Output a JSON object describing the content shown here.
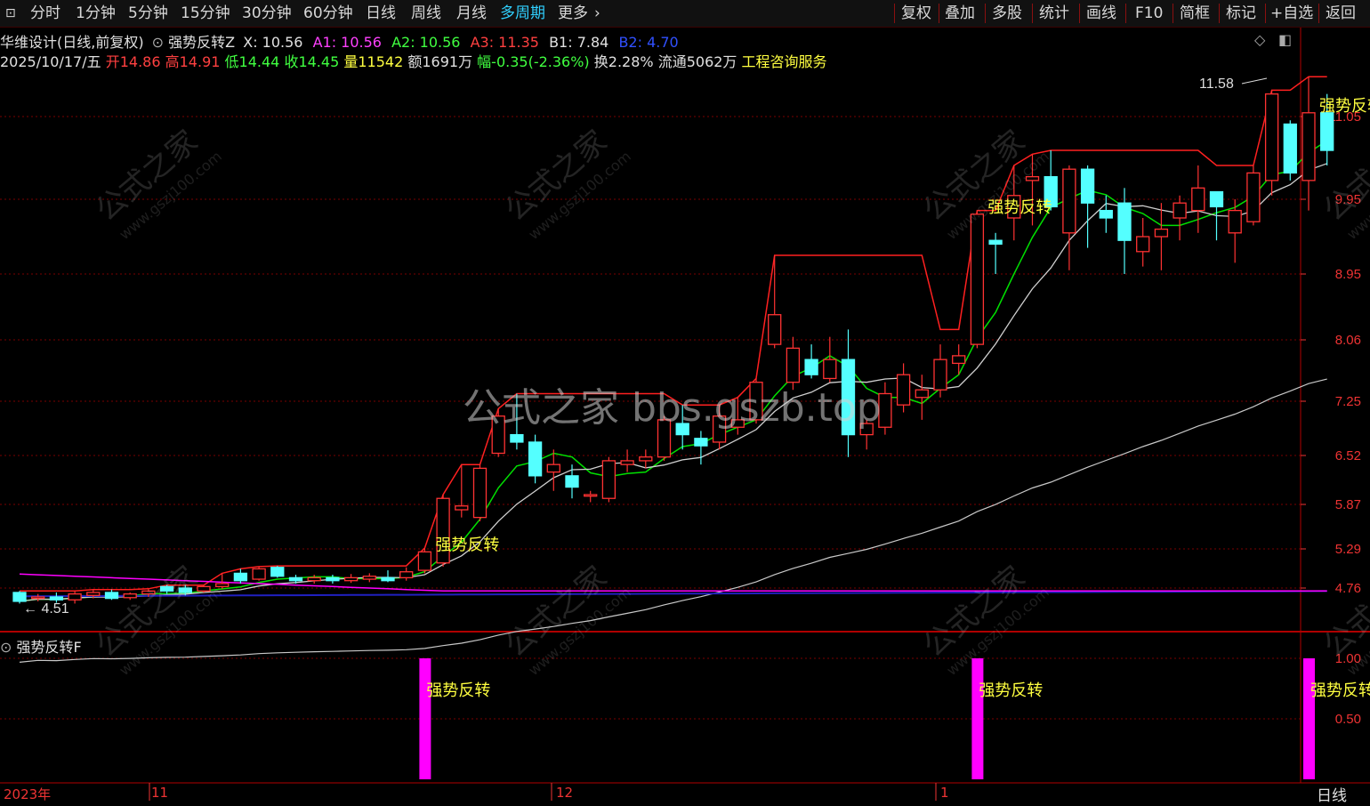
{
  "toolbar": {
    "left": [
      "分时",
      "1分钟",
      "5分钟",
      "15分钟",
      "30分钟",
      "60分钟",
      "日线",
      "周线",
      "月线",
      "多周期",
      "更多"
    ],
    "right": [
      "复权",
      "叠加",
      "多股",
      "统计",
      "画线",
      "F10",
      "简框",
      "标记",
      "+自选",
      "返回"
    ]
  },
  "header": {
    "line1": {
      "title": "华维设计(日线,前复权)",
      "indicator": "强势反转Z",
      "x": "X: 10.56",
      "a1": "A1: 10.56",
      "a2": "A2: 10.56",
      "a3": "A3: 11.35",
      "b1": "B1: 7.84",
      "b2": "B2: 4.70"
    },
    "line2": {
      "date": "2025/10/17/五",
      "open": "开14.86",
      "high": "高14.91",
      "low": "低14.44",
      "close": "收14.45",
      "volume": "量11542",
      "amount": "额1691万",
      "change": "幅-0.35(-2.36%)",
      "turnover": "换2.28%",
      "float": "流通5062万",
      "industry": "工程咨询服务"
    }
  },
  "sub_panel": {
    "title": "强势反转F"
  },
  "bottom": {
    "period_label": "日线",
    "year": "2023年",
    "month_11": "11",
    "month_12": "12",
    "month_1": "1"
  },
  "watermark": "公式之家 bbs.gszb.top",
  "watermark_small": "公式之家",
  "watermark_url": "www.gszj100.com",
  "colors": {
    "up": "#ff3232",
    "down": "#54ffff",
    "ma": "#00e000",
    "white": "#d0d0d0",
    "magenta": "#ff00ff",
    "blue": "#2020c0",
    "grid": "#7a0000",
    "yellow": "#ffff40"
  },
  "chart_data": {
    "type": "candlestick",
    "y_ticks": [
      "11.05",
      "9.95",
      "8.95",
      "8.06",
      "7.25",
      "6.52",
      "5.87",
      "5.29",
      "4.76"
    ],
    "sub_y_ticks": [
      "1.00",
      "0.50"
    ],
    "low_label": "4.51",
    "high_label": "11.58",
    "signal_label": "强势反转",
    "candles": [
      {
        "o": 4.7,
        "c": 4.58,
        "h": 4.72,
        "l": 4.55
      },
      {
        "o": 4.62,
        "c": 4.64,
        "h": 4.68,
        "l": 4.58
      },
      {
        "o": 4.64,
        "c": 4.6,
        "h": 4.7,
        "l": 4.56
      },
      {
        "o": 4.6,
        "c": 4.68,
        "h": 4.72,
        "l": 4.55
      },
      {
        "o": 4.66,
        "c": 4.7,
        "h": 4.74,
        "l": 4.62
      },
      {
        "o": 4.7,
        "c": 4.62,
        "h": 4.74,
        "l": 4.6
      },
      {
        "o": 4.63,
        "c": 4.68,
        "h": 4.7,
        "l": 4.6
      },
      {
        "o": 4.68,
        "c": 4.72,
        "h": 4.75,
        "l": 4.64
      },
      {
        "o": 4.78,
        "c": 4.72,
        "h": 4.8,
        "l": 4.68
      },
      {
        "o": 4.76,
        "c": 4.7,
        "h": 4.8,
        "l": 4.66
      },
      {
        "o": 4.72,
        "c": 4.78,
        "h": 4.8,
        "l": 4.7
      },
      {
        "o": 4.78,
        "c": 4.82,
        "h": 4.96,
        "l": 4.75
      },
      {
        "o": 4.96,
        "c": 4.86,
        "h": 5.02,
        "l": 4.82
      },
      {
        "o": 4.88,
        "c": 5.02,
        "h": 5.05,
        "l": 4.86
      },
      {
        "o": 5.04,
        "c": 4.92,
        "h": 5.06,
        "l": 4.9
      },
      {
        "o": 4.9,
        "c": 4.86,
        "h": 4.94,
        "l": 4.82
      },
      {
        "o": 4.86,
        "c": 4.9,
        "h": 4.94,
        "l": 4.82
      },
      {
        "o": 4.9,
        "c": 4.86,
        "h": 4.94,
        "l": 4.82
      },
      {
        "o": 4.86,
        "c": 4.9,
        "h": 4.95,
        "l": 4.83
      },
      {
        "o": 4.88,
        "c": 4.92,
        "h": 4.96,
        "l": 4.84
      },
      {
        "o": 4.9,
        "c": 4.86,
        "h": 5.0,
        "l": 4.84
      },
      {
        "o": 4.9,
        "c": 4.98,
        "h": 5.04,
        "l": 4.86
      },
      {
        "o": 5.0,
        "c": 5.25,
        "h": 5.3,
        "l": 4.96
      },
      {
        "o": 5.1,
        "c": 5.95,
        "h": 6.0,
        "l": 5.05
      },
      {
        "o": 5.8,
        "c": 5.85,
        "h": 6.4,
        "l": 5.7
      },
      {
        "o": 5.7,
        "c": 6.35,
        "h": 6.4,
        "l": 5.65
      },
      {
        "o": 6.55,
        "c": 7.05,
        "h": 7.15,
        "l": 6.5
      },
      {
        "o": 6.8,
        "c": 6.7,
        "h": 7.35,
        "l": 6.6
      },
      {
        "o": 6.7,
        "c": 6.25,
        "h": 6.8,
        "l": 6.15
      },
      {
        "o": 6.3,
        "c": 6.4,
        "h": 6.6,
        "l": 6.05
      },
      {
        "o": 6.25,
        "c": 6.1,
        "h": 6.4,
        "l": 5.95
      },
      {
        "o": 5.98,
        "c": 6.0,
        "h": 6.05,
        "l": 5.9
      },
      {
        "o": 5.95,
        "c": 6.45,
        "h": 6.5,
        "l": 5.9
      },
      {
        "o": 6.4,
        "c": 6.45,
        "h": 6.6,
        "l": 6.3
      },
      {
        "o": 6.45,
        "c": 6.5,
        "h": 6.6,
        "l": 6.35
      },
      {
        "o": 6.5,
        "c": 7.0,
        "h": 7.05,
        "l": 6.45
      },
      {
        "o": 6.95,
        "c": 6.8,
        "h": 7.2,
        "l": 6.6
      },
      {
        "o": 6.75,
        "c": 6.65,
        "h": 6.85,
        "l": 6.4
      },
      {
        "o": 6.7,
        "c": 7.05,
        "h": 7.2,
        "l": 6.6
      },
      {
        "o": 6.9,
        "c": 7.0,
        "h": 7.3,
        "l": 6.8
      },
      {
        "o": 7.0,
        "c": 7.5,
        "h": 7.55,
        "l": 6.95
      },
      {
        "o": 8.0,
        "c": 8.4,
        "h": 9.2,
        "l": 7.95
      },
      {
        "o": 7.5,
        "c": 7.95,
        "h": 8.1,
        "l": 7.4
      },
      {
        "o": 7.8,
        "c": 7.6,
        "h": 8.0,
        "l": 7.55
      },
      {
        "o": 7.55,
        "c": 7.8,
        "h": 8.1,
        "l": 7.5
      },
      {
        "o": 7.8,
        "c": 6.8,
        "h": 8.2,
        "l": 6.5
      },
      {
        "o": 6.8,
        "c": 6.95,
        "h": 7.0,
        "l": 6.6
      },
      {
        "o": 6.9,
        "c": 7.35,
        "h": 7.5,
        "l": 6.8
      },
      {
        "o": 7.2,
        "c": 7.6,
        "h": 7.75,
        "l": 7.1
      },
      {
        "o": 7.3,
        "c": 7.4,
        "h": 7.6,
        "l": 7.0
      },
      {
        "o": 7.4,
        "c": 7.8,
        "h": 8.0,
        "l": 7.3
      },
      {
        "o": 7.75,
        "c": 7.85,
        "h": 8.0,
        "l": 7.6
      },
      {
        "o": 8.0,
        "c": 9.75,
        "h": 9.8,
        "l": 7.95
      },
      {
        "o": 9.4,
        "c": 9.35,
        "h": 9.5,
        "l": 8.95
      },
      {
        "o": 9.7,
        "c": 10.0,
        "h": 10.4,
        "l": 9.4
      },
      {
        "o": 10.2,
        "c": 10.25,
        "h": 10.55,
        "l": 9.6
      },
      {
        "o": 10.25,
        "c": 9.85,
        "h": 10.6,
        "l": 9.8
      },
      {
        "o": 9.5,
        "c": 10.35,
        "h": 10.4,
        "l": 9.0
      },
      {
        "o": 10.35,
        "c": 9.9,
        "h": 10.4,
        "l": 9.3
      },
      {
        "o": 9.8,
        "c": 9.7,
        "h": 10.0,
        "l": 9.5
      },
      {
        "o": 9.9,
        "c": 9.4,
        "h": 10.1,
        "l": 8.95
      },
      {
        "o": 9.25,
        "c": 9.45,
        "h": 9.7,
        "l": 9.05
      },
      {
        "o": 9.45,
        "c": 9.55,
        "h": 9.9,
        "l": 9.0
      },
      {
        "o": 9.7,
        "c": 9.9,
        "h": 10.0,
        "l": 9.4
      },
      {
        "o": 9.8,
        "c": 10.1,
        "h": 10.4,
        "l": 9.5
      },
      {
        "o": 10.05,
        "c": 9.85,
        "h": 10.05,
        "l": 9.4
      },
      {
        "o": 9.5,
        "c": 9.8,
        "h": 9.95,
        "l": 9.1
      },
      {
        "o": 9.65,
        "c": 10.3,
        "h": 10.4,
        "l": 9.6
      },
      {
        "o": 10.2,
        "c": 11.35,
        "h": 11.4,
        "l": 10.0
      },
      {
        "o": 10.95,
        "c": 10.3,
        "h": 11.0,
        "l": 10.2
      },
      {
        "o": 10.2,
        "c": 11.1,
        "h": 11.58,
        "l": 9.8
      },
      {
        "o": 11.1,
        "c": 10.6,
        "h": 11.35,
        "l": 10.4
      }
    ],
    "signal_indices": [
      22,
      52,
      70
    ]
  }
}
